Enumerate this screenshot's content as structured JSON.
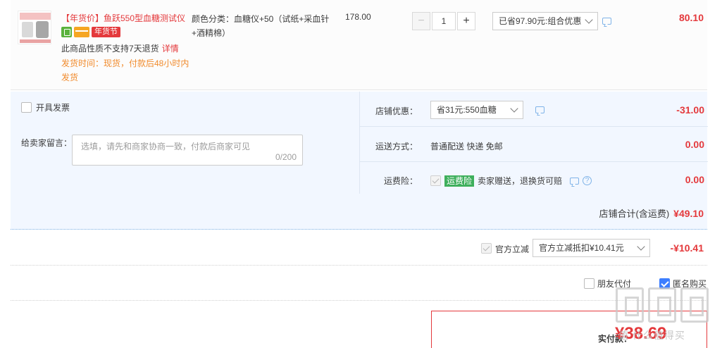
{
  "product": {
    "title": "【年货价】鱼跃550型血糖测试仪",
    "badge_festival": "年货节",
    "no_return_text": "此商品性质不支持7天退货",
    "detail_link": "详情",
    "ship_time": "发货时间：现货，付款后48小时内发货",
    "sku": "颜色分类：血糖仪+50（试纸+采血针+酒精棉）",
    "unit_price": "178.00",
    "qty_minus": "−",
    "quantity": "1",
    "qty_plus": "+",
    "promo_select": "已省97.90元:组合优惠",
    "line_total": "80.10"
  },
  "shop": {
    "invoice_label": "开具发票",
    "message_label": "给卖家留言：",
    "message_placeholder": "选填，请先和商家协商一致，付款后商家可见",
    "message_counter": "0/200",
    "discount_label": "店铺优惠：",
    "discount_select": "省31元:550血糖",
    "discount_value": "-31.00",
    "shipping_label": "运送方式：",
    "shipping_method": "普通配送 快递 免邮",
    "shipping_value": "0.00",
    "insurance_label": "运费险：",
    "insurance_badge": "运费险",
    "insurance_text": "卖家赠送，退换货可赔",
    "insurance_value": "0.00",
    "total_label": "店铺合计(含运费)",
    "total_value": "¥49.10"
  },
  "official": {
    "label": "官方立减",
    "select": "官方立减抵扣¥10.41元",
    "value": "-¥10.41"
  },
  "options": {
    "friend_pay": "朋友代付",
    "anonymous": "匿名购买"
  },
  "pay": {
    "label": "实付款：",
    "amount": "¥38.69"
  },
  "watermark": {
    "text": "值 什么值得买"
  },
  "colors": {
    "accent_red": "#e4393c",
    "panel_blue": "#f2f7ff",
    "insurance_green": "#3eaf5c",
    "checkbox_blue": "#3d7eff"
  },
  "icons": [
    "message-icon",
    "help-icon",
    "chevron-down-icon",
    "checkbox-icon"
  ]
}
